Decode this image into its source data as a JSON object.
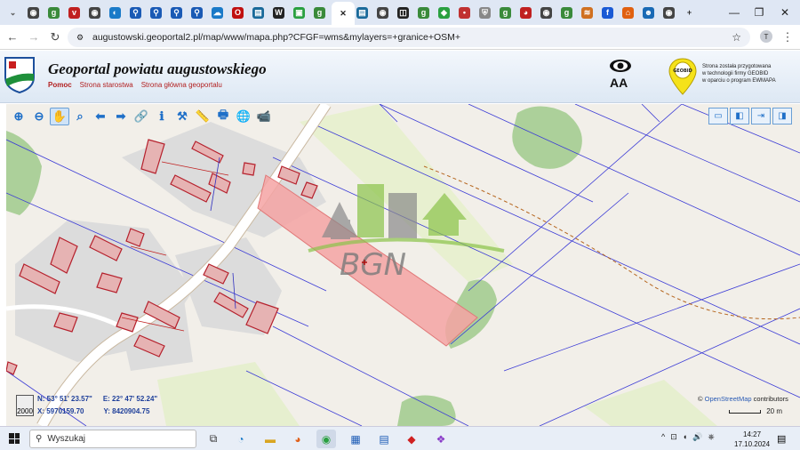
{
  "browser": {
    "url": "augustowski.geoportal2.pl/map/www/mapa.php?CFGF=wms&mylayers=+granice+OSM+",
    "tabs": [
      {
        "icon": "tab-menu",
        "label": "⌄",
        "color": "#555"
      },
      {
        "icon": "globe-icon",
        "label": "◉",
        "color": "#444"
      },
      {
        "icon": "g-icon",
        "label": "g",
        "color": "#3a8a3a"
      },
      {
        "icon": "vr-icon",
        "label": "v",
        "color": "#c02020"
      },
      {
        "icon": "globe-icon",
        "label": "◉",
        "color": "#444"
      },
      {
        "icon": "swirl-icon",
        "label": "◐",
        "color": "#1a7ac8"
      },
      {
        "icon": "search-icon",
        "label": "⚲",
        "color": "#1a5ab5"
      },
      {
        "icon": "search-icon",
        "label": "⚲",
        "color": "#1a5ab5"
      },
      {
        "icon": "search-icon",
        "label": "⚲",
        "color": "#1a5ab5"
      },
      {
        "icon": "search-icon",
        "label": "⚲",
        "color": "#1a5ab5"
      },
      {
        "icon": "cloud-icon",
        "label": "☁",
        "color": "#1a7ac8"
      },
      {
        "icon": "opera-icon",
        "label": "O",
        "color": "#c01010"
      },
      {
        "icon": "stack-icon",
        "label": "▤",
        "color": "#1a6a9a"
      },
      {
        "icon": "wiki-icon",
        "label": "W",
        "color": "#222"
      },
      {
        "icon": "square-icon",
        "label": "▣",
        "color": "#2aa040"
      },
      {
        "icon": "g-icon",
        "label": "g",
        "color": "#3a8a3a"
      },
      {
        "icon": "close-icon",
        "label": "✕",
        "color": "#222"
      },
      {
        "icon": "stack-icon",
        "label": "▤",
        "color": "#1a6a9a"
      },
      {
        "icon": "globe-icon",
        "label": "◉",
        "color": "#444"
      },
      {
        "icon": "frame-icon",
        "label": "◫",
        "color": "#222"
      },
      {
        "icon": "g-icon",
        "label": "g",
        "color": "#3a8a3a"
      },
      {
        "icon": "maps-icon",
        "label": "◆",
        "color": "#2aa040"
      },
      {
        "icon": "dot-icon",
        "label": "•",
        "color": "#c03030"
      },
      {
        "icon": "shield-icon",
        "label": "⛨",
        "color": "#888"
      },
      {
        "icon": "g-icon",
        "label": "g",
        "color": "#3a8a3a"
      },
      {
        "icon": "circle-icon",
        "label": "◕",
        "color": "#c02020"
      },
      {
        "icon": "globe-icon",
        "label": "◉",
        "color": "#444"
      },
      {
        "icon": "g-icon",
        "label": "g",
        "color": "#3a8a3a"
      },
      {
        "icon": "burger-icon",
        "label": "≋",
        "color": "#d07020"
      },
      {
        "icon": "facebook-icon",
        "label": "f",
        "color": "#1a5ad5"
      },
      {
        "icon": "house-icon",
        "label": "⌂",
        "color": "#e06010"
      },
      {
        "icon": "people-icon",
        "label": "☻",
        "color": "#1a6ab5"
      },
      {
        "icon": "globe-icon",
        "label": "◉",
        "color": "#444"
      },
      {
        "icon": "new-tab-icon",
        "label": "+",
        "color": "#333"
      }
    ],
    "window_controls": {
      "minimize": "—",
      "restore": "❐",
      "close": "✕"
    },
    "profile_initial": "T"
  },
  "header": {
    "title": "Geoportal powiatu augustowskiego",
    "links": [
      "Pomoc",
      "Strona starostwa",
      "Strona główna geoportalu"
    ],
    "font_toggle": "AA",
    "geobid_note_lines": [
      "Strona została przygotowana",
      "w technologii firmy GEOBID",
      "w oparciu o program EWMAPA"
    ],
    "geobid_logo_text": "GEOBID"
  },
  "toolbar": {
    "tools": [
      "zoom-in",
      "zoom-out",
      "pan",
      "zoom-area",
      "back",
      "forward",
      "link",
      "info",
      "measure",
      "ruler",
      "print",
      "globe",
      "camera"
    ],
    "tool_glyphs": [
      "⊕",
      "⊖",
      "✋",
      "⌕",
      "⬅",
      "➡",
      "🔗",
      "ℹ",
      "⚒",
      "📏",
      "🖶",
      "🌐",
      "📹"
    ],
    "selected": "pan",
    "right": [
      "layout-1",
      "layout-2",
      "export",
      "panel"
    ],
    "right_glyphs": [
      "▭",
      "◧",
      "⇥",
      "◨"
    ]
  },
  "map": {
    "watermark": "BGN",
    "scale_label": "2000",
    "coords": {
      "n": "N:  53° 51' 23.57\"",
      "e": "E:  22° 47' 52.24\"",
      "x": "X:  5970159.70",
      "y": "Y:  8420904.75"
    },
    "attribution": {
      "prefix": "©",
      "link": "OpenStreetMap",
      "suffix": "contributors"
    },
    "scalebar": "20 m",
    "colors": {
      "parcel_highlight": "#f4a3a3",
      "building": "#e6b3b3",
      "landuse": "#dcdcdc",
      "forest": "#acd09a",
      "road": "#ffffff"
    }
  },
  "taskbar": {
    "search_placeholder": "Wyszukaj",
    "time": "14:27",
    "date": "17.10.2024",
    "apps": [
      "task-view",
      "edge",
      "explorer",
      "firefox",
      "chrome",
      "calculator",
      "calendar",
      "maps-pin",
      "copilot"
    ],
    "app_glyphs": [
      "⧉",
      "◔",
      "▬",
      "◕",
      "◉",
      "▦",
      "▤",
      "◆",
      "❖"
    ],
    "tray": [
      "^",
      "⊡",
      "◖",
      "🔊",
      "⎈"
    ]
  }
}
